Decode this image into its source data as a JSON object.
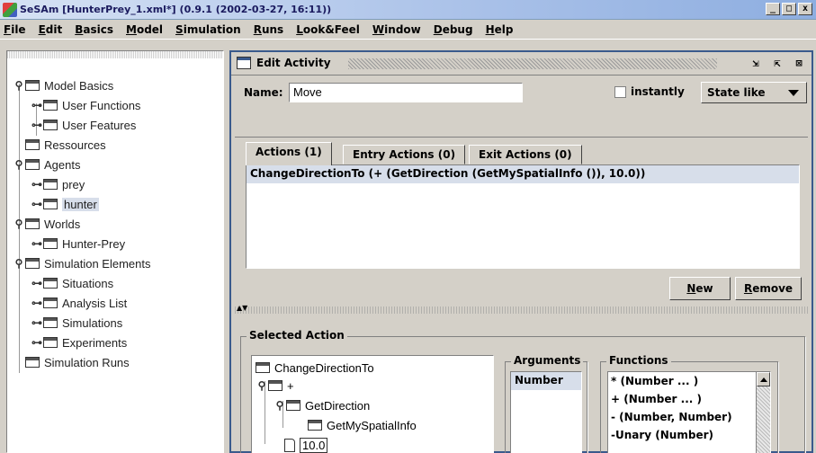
{
  "window": {
    "title": "SeSAm [HunterPrey_1.xml*] (0.9.1 (2002-03-27, 16:11))",
    "buttons": [
      "_",
      "□",
      "x"
    ]
  },
  "menu": [
    "File",
    "Edit",
    "Basics",
    "Model",
    "Simulation",
    "Runs",
    "Look&Feel",
    "Window",
    "Debug",
    "Help"
  ],
  "tree": {
    "items": [
      {
        "label": "Model Basics"
      },
      {
        "label": "User Functions"
      },
      {
        "label": "User Features"
      },
      {
        "label": "Ressources"
      },
      {
        "label": "Agents"
      },
      {
        "label": "prey"
      },
      {
        "label": "hunter"
      },
      {
        "label": "Worlds"
      },
      {
        "label": "Hunter-Prey"
      },
      {
        "label": "Simulation Elements"
      },
      {
        "label": "Situations"
      },
      {
        "label": "Analysis List"
      },
      {
        "label": "Simulations"
      },
      {
        "label": "Experiments"
      },
      {
        "label": "Simulation Runs"
      }
    ],
    "selected": "hunter"
  },
  "edit_activity": {
    "title": "Edit Activity",
    "name_label": "Name:",
    "name_value": "Move",
    "instantly_label": "instantly",
    "instantly_checked": false,
    "state_select": "State like",
    "tabs": [
      "Actions (1)",
      "Entry Actions (0)",
      "Exit Actions (0)"
    ],
    "active_tab": "Actions (1)",
    "actions": [
      "ChangeDirectionTo (+ (GetDirection (GetMySpatialInfo ()), 10.0))"
    ],
    "new_button": "New",
    "remove_button": "Remove",
    "selected_action": {
      "group_title": "Selected Action",
      "tree": [
        "ChangeDirectionTo",
        "+",
        "GetDirection",
        "GetMySpatialInfo",
        "10.0"
      ],
      "arguments_title": "Arguments",
      "arguments": [
        "Number"
      ],
      "functions_title": "Functions",
      "functions": [
        "* (Number ... )",
        "+ (Number ... )",
        "- (Number, Number)",
        "-Unary (Number)"
      ]
    }
  },
  "colors": {
    "selection": "#d7deea",
    "frame_border": "#3a5a8c",
    "window_bg": "#d4d0c8"
  }
}
